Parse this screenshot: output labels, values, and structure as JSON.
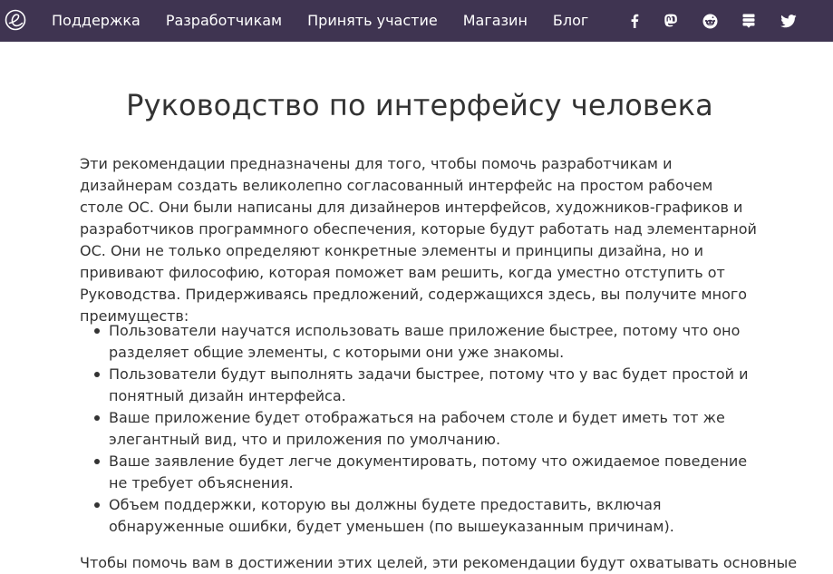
{
  "nav": {
    "links": [
      "Поддержка",
      "Разработчикам",
      "Принять участие",
      "Магазин",
      "Блог"
    ],
    "social": [
      "facebook-icon",
      "mastodon-icon",
      "reddit-icon",
      "stack-icon",
      "twitter-icon"
    ]
  },
  "colors": {
    "navbar_bg": "#3f3451",
    "text": "#333333"
  },
  "page": {
    "title": "Руководство по интерфейсу человека",
    "intro": "Эти рекомендации предназначены для того, чтобы помочь разработчикам и дизайнерам создать великолепно согласованный интерфейс на простом рабочем столе ОС. Они были написаны для дизайнеров интерфейсов, художников-графиков и разработчиков программного обеспечения, которые будут работать над элементарной ОС. Они не только определяют конкретные элементы и принципы дизайна, но и прививают философию, которая поможет вам решить, когда уместно отступить от Руководства. Придерживаясь предложений, содержащихся здесь, вы получите много преимуществ:",
    "benefits": [
      "Пользователи научатся использовать ваше приложение быстрее, потому что оно разделяет общие элементы, с которыми они уже знакомы.",
      "Пользователи будут выполнять задачи быстрее, потому что у вас будет простой и понятный дизайн интерфейса.",
      "Ваше приложение будет отображаться на рабочем столе и будет иметь тот же элегантный вид, что и приложения по умолчанию.",
      "Ваше заявление будет легче документировать, потому что ожидаемое поведение не требует объяснения.",
      "Объем поддержки, которую вы должны будете предоставить, включая обнаруженные ошибки, будет уменьшен (по вышеуказанным причинам)."
    ],
    "outro": "Чтобы помочь вам в достижении этих целей, эти рекомендации будут охватывать основные"
  }
}
